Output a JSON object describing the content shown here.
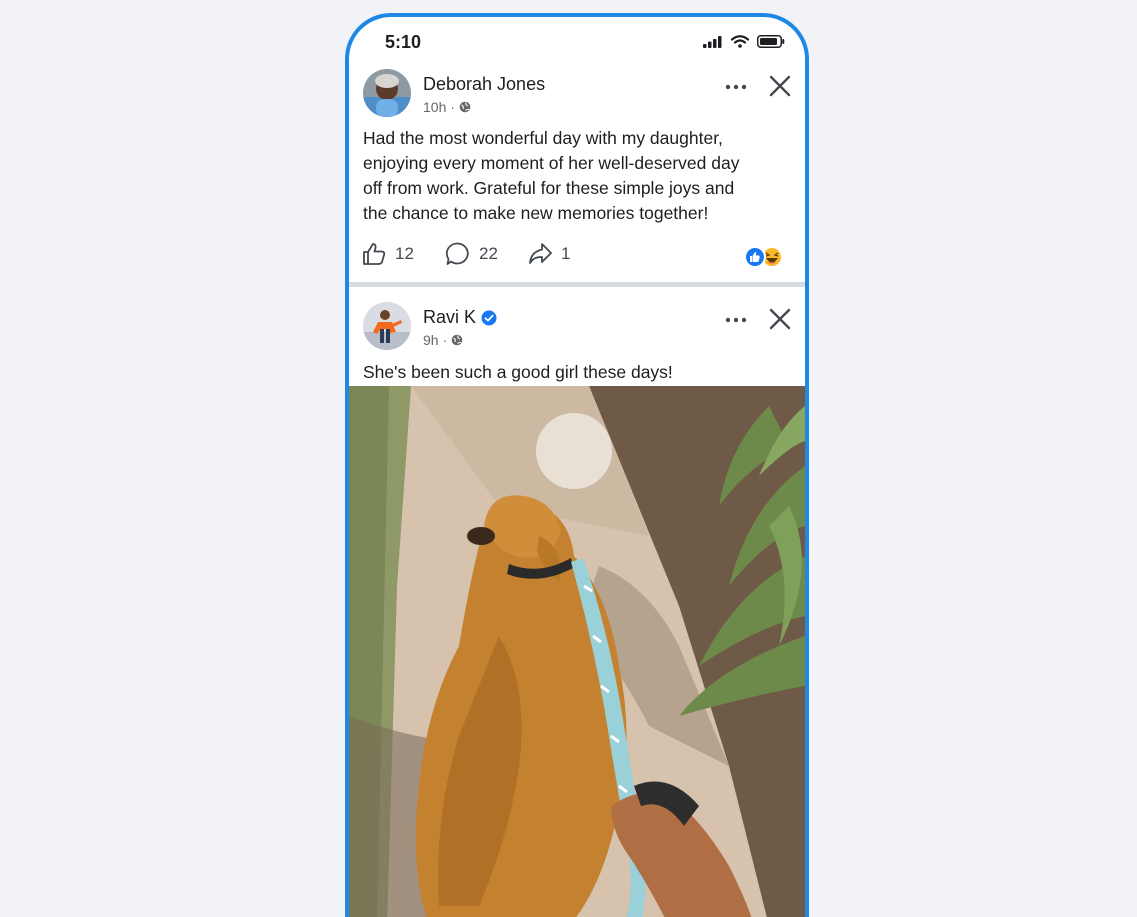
{
  "status_bar": {
    "time": "5:10"
  },
  "posts": [
    {
      "author": "Deborah Jones",
      "time": "10h",
      "text_lines": [
        "Had the most wonderful day with my daughter,",
        "enjoying every moment of her well-deserved day",
        "off from work. Grateful for these simple joys and",
        "the chance to make new memories together!"
      ],
      "likes": "12",
      "comments": "22",
      "shares": "1"
    },
    {
      "author": "Ravi K",
      "verified": true,
      "time": "9h",
      "text": "She's been such a good girl these days!"
    }
  ],
  "colors": {
    "accent": "#1e88e5",
    "verified": "#1877f2",
    "like_reaction": "#1877f2",
    "haha_reaction": "#f7b928",
    "background": "#f1f3f7"
  },
  "icons": [
    "signal-icon",
    "wifi-icon",
    "battery-icon",
    "globe-icon",
    "more-icon",
    "close-icon",
    "like-icon",
    "comment-icon",
    "share-icon",
    "verified-icon",
    "play-icon"
  ]
}
